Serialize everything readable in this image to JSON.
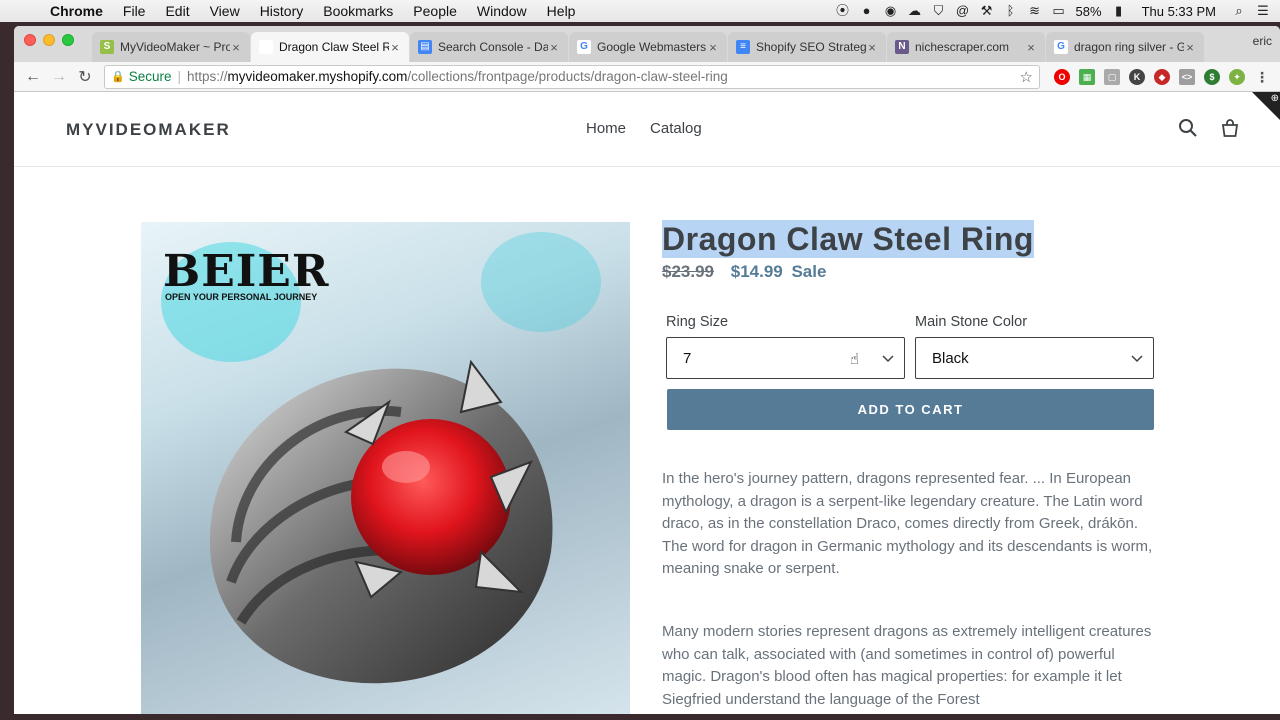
{
  "menubar": {
    "app": "Chrome",
    "items": [
      "File",
      "Edit",
      "View",
      "History",
      "Bookmarks",
      "People",
      "Window",
      "Help"
    ],
    "battery": "58%",
    "clock": "Thu 5:33 PM"
  },
  "tabs": [
    {
      "label": "MyVideoMaker ~ Pro",
      "icon": "shopify-icon",
      "color": "#95bf47"
    },
    {
      "label": "Dragon Claw Steel R",
      "icon": "page-icon",
      "color": "#ffffff",
      "active": true
    },
    {
      "label": "Search Console - Da",
      "icon": "search-console-icon",
      "color": "#4285f4"
    },
    {
      "label": "Google Webmasters",
      "icon": "google-icon",
      "color": "#ffffff"
    },
    {
      "label": "Shopify SEO Strateg",
      "icon": "docs-icon",
      "color": "#4285f4"
    },
    {
      "label": "nichescraper.com",
      "icon": "n-icon",
      "color": "#6a5a8c"
    },
    {
      "label": "dragon ring silver - G",
      "icon": "google-icon",
      "color": "#ffffff"
    }
  ],
  "tab_user": "eric",
  "address": {
    "secure_label": "Secure",
    "scheme": "https://",
    "host": "myvideomaker.myshopify.com",
    "path": "/collections/frontpage/products/dragon-claw-steel-ring"
  },
  "store": {
    "logo": "MYVIDEOMAKER",
    "nav": [
      "Home",
      "Catalog"
    ]
  },
  "product": {
    "image_brand": "BEIER",
    "image_tagline": "OPEN YOUR PERSONAL JOURNEY",
    "title": "Dragon Claw Steel Ring",
    "price_old": "$23.99",
    "price_new": "$14.99",
    "sale_label": "Sale",
    "option1_label": "Ring Size",
    "option1_value": "7",
    "option2_label": "Main Stone Color",
    "option2_value": "Black",
    "add_to_cart": "ADD TO CART",
    "desc_p1": "In the hero's journey pattern, dragons represented fear. ... In European mythology, a dragon is a serpent-like legendary creature. The Latin word draco, as in the constellation Draco, comes directly from Greek, drákōn. The word for dragon in Germanic mythology and its descendants is worm, meaning snake or serpent.",
    "desc_p2": "Many modern stories represent dragons as extremely intelligent creatures who can talk, associated with (and sometimes in control of) powerful magic. Dragon's blood often has magical properties: for example it let Siegfried understand the language of the Forest"
  },
  "colors": {
    "accent": "#557b97",
    "text": "#3d4246",
    "muted": "#69727b",
    "highlight": "#b8d4f5",
    "gem": "#e0141c"
  }
}
